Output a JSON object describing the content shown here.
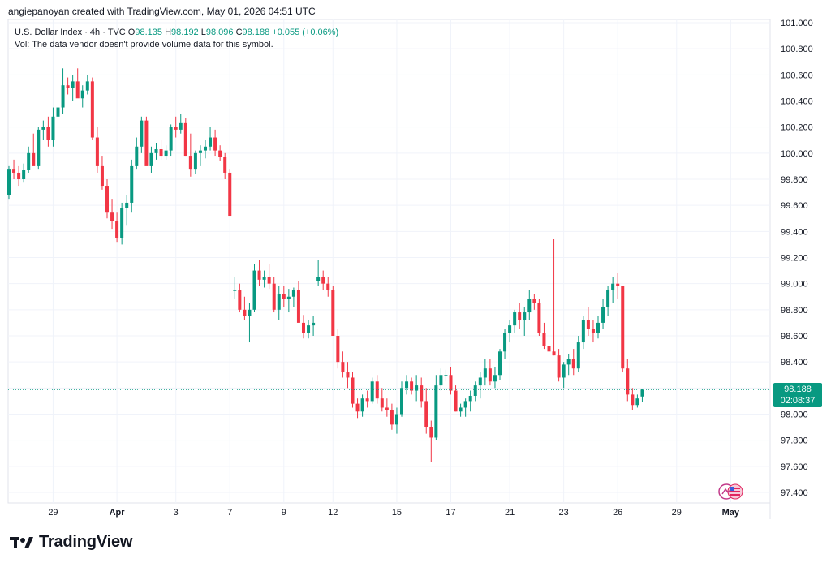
{
  "header": {
    "caption": "angiepanoyan created with TradingView.com, May 01, 2026 04:51 UTC"
  },
  "legend": {
    "symbol": "U.S. Dollar Index · 4h · TVC",
    "open_label": "O",
    "open": "98.135",
    "high_label": "H",
    "high": "98.192",
    "low_label": "L",
    "low": "98.096",
    "close_label": "C",
    "close": "98.188",
    "change": "+0.055 (+0.06%)",
    "volume_note": "Vol: The data vendor doesn't provide volume data for this symbol."
  },
  "price_tag": {
    "price": "98.188",
    "countdown": "02:08:37"
  },
  "footer": {
    "brand": "TradingView",
    "logo_icon": "tradingview-logo-icon"
  },
  "colors": {
    "up": "#089981",
    "down": "#f23645",
    "grid": "#f0f3fa",
    "text": "#131722"
  },
  "chart_data": {
    "type": "candlestick",
    "timeframe": "4h",
    "y_axis": {
      "min": 97.3,
      "max": 101.0,
      "ticks": [
        "101.000",
        "100.800",
        "100.600",
        "100.400",
        "100.200",
        "100.000",
        "99.800",
        "99.600",
        "99.400",
        "99.200",
        "99.000",
        "98.800",
        "98.600",
        "98.400",
        "98.200",
        "98.000",
        "97.800",
        "97.600",
        "97.400"
      ]
    },
    "x_axis": {
      "ticks": [
        {
          "label": "29",
          "bar": 9,
          "bold": false
        },
        {
          "label": "Apr",
          "bar": 22,
          "bold": true
        },
        {
          "label": "3",
          "bar": 34,
          "bold": false
        },
        {
          "label": "7",
          "bar": 45,
          "bold": false
        },
        {
          "label": "9",
          "bar": 56,
          "bold": false
        },
        {
          "label": "12",
          "bar": 66,
          "bold": false
        },
        {
          "label": "15",
          "bar": 79,
          "bold": false
        },
        {
          "label": "17",
          "bar": 90,
          "bold": false
        },
        {
          "label": "21",
          "bar": 102,
          "bold": false
        },
        {
          "label": "23",
          "bar": 113,
          "bold": false
        },
        {
          "label": "26",
          "bar": 124,
          "bold": false
        },
        {
          "label": "29",
          "bar": 136,
          "bold": false
        },
        {
          "label": "May",
          "bar": 147,
          "bold": true
        }
      ]
    },
    "last_price": 98.188,
    "grid": true,
    "candles": [
      [
        99.68,
        99.9,
        99.65,
        99.88
      ],
      [
        99.88,
        99.95,
        99.8,
        99.85
      ],
      [
        99.85,
        99.9,
        99.75,
        99.8
      ],
      [
        99.8,
        99.92,
        99.78,
        99.87
      ],
      [
        99.87,
        100.05,
        99.85,
        100.0
      ],
      [
        100.0,
        100.15,
        99.95,
        99.9
      ],
      [
        99.9,
        100.2,
        99.88,
        100.18
      ],
      [
        100.18,
        100.25,
        100.1,
        100.2
      ],
      [
        100.2,
        100.28,
        100.05,
        100.1
      ],
      [
        100.1,
        100.35,
        100.05,
        100.28
      ],
      [
        100.28,
        100.45,
        100.22,
        100.35
      ],
      [
        100.35,
        100.65,
        100.3,
        100.52
      ],
      [
        100.52,
        100.58,
        100.45,
        100.5
      ],
      [
        100.5,
        100.6,
        100.4,
        100.55
      ],
      [
        100.55,
        100.65,
        100.48,
        100.42
      ],
      [
        100.42,
        100.52,
        100.35,
        100.48
      ],
      [
        100.48,
        100.6,
        100.45,
        100.55
      ],
      [
        100.55,
        100.58,
        100.1,
        100.12
      ],
      [
        100.12,
        100.2,
        99.85,
        99.9
      ],
      [
        99.9,
        99.98,
        99.72,
        99.75
      ],
      [
        99.75,
        99.8,
        99.5,
        99.55
      ],
      [
        99.55,
        99.65,
        99.42,
        99.48
      ],
      [
        99.48,
        99.55,
        99.32,
        99.35
      ],
      [
        99.35,
        99.62,
        99.3,
        99.58
      ],
      [
        99.58,
        99.68,
        99.45,
        99.62
      ],
      [
        99.62,
        99.95,
        99.55,
        99.9
      ],
      [
        99.9,
        100.12,
        99.88,
        100.05
      ],
      [
        100.05,
        100.28,
        100.0,
        100.25
      ],
      [
        100.25,
        100.28,
        99.95,
        99.9
      ],
      [
        99.9,
        100.05,
        99.85,
        100.0
      ],
      [
        100.0,
        100.08,
        99.95,
        100.03
      ],
      [
        100.03,
        100.1,
        99.95,
        99.98
      ],
      [
        99.98,
        100.06,
        99.95,
        100.02
      ],
      [
        100.02,
        100.22,
        99.98,
        100.2
      ],
      [
        100.2,
        100.28,
        100.12,
        100.18
      ],
      [
        100.18,
        100.3,
        100.15,
        100.23
      ],
      [
        100.23,
        100.27,
        99.98,
        99.98
      ],
      [
        99.98,
        100.15,
        99.82,
        99.88
      ],
      [
        99.88,
        100.02,
        99.84,
        100.0
      ],
      [
        100.0,
        100.06,
        99.9,
        100.02
      ],
      [
        100.02,
        100.1,
        99.96,
        100.05
      ],
      [
        100.05,
        100.2,
        100.02,
        100.12
      ],
      [
        100.12,
        100.18,
        99.98,
        100.02
      ],
      [
        100.02,
        100.06,
        99.94,
        99.97
      ],
      [
        99.97,
        100.0,
        99.8,
        99.85
      ],
      [
        99.85,
        99.88,
        99.6,
        99.52
      ],
      [
        98.95,
        99.05,
        98.88,
        98.95
      ],
      [
        98.95,
        99.0,
        98.78,
        98.8
      ],
      [
        98.8,
        98.9,
        98.72,
        98.75
      ],
      [
        98.75,
        98.85,
        98.55,
        98.8
      ],
      [
        98.8,
        99.15,
        98.78,
        99.1
      ],
      [
        99.1,
        99.18,
        98.98,
        99.03
      ],
      [
        99.03,
        99.1,
        98.97,
        99.05
      ],
      [
        99.05,
        99.15,
        98.96,
        99.0
      ],
      [
        99.0,
        99.05,
        98.78,
        98.8
      ],
      [
        98.8,
        98.98,
        98.72,
        98.92
      ],
      [
        98.92,
        98.98,
        98.82,
        98.88
      ],
      [
        98.88,
        98.96,
        98.78,
        98.9
      ],
      [
        98.9,
        98.97,
        98.82,
        98.95
      ],
      [
        98.95,
        99.02,
        98.75,
        98.7
      ],
      [
        98.7,
        98.76,
        98.58,
        98.62
      ],
      [
        98.62,
        98.72,
        98.58,
        98.68
      ],
      [
        98.68,
        98.75,
        98.6,
        98.7
      ],
      [
        99.02,
        99.18,
        98.98,
        99.05
      ],
      [
        99.05,
        99.1,
        98.95,
        99.0
      ],
      [
        99.0,
        99.05,
        98.9,
        98.95
      ],
      [
        98.95,
        98.98,
        98.6,
        98.6
      ],
      [
        98.6,
        98.65,
        98.35,
        98.4
      ],
      [
        98.4,
        98.48,
        98.28,
        98.32
      ],
      [
        98.32,
        98.4,
        98.2,
        98.28
      ],
      [
        98.28,
        98.32,
        98.05,
        98.08
      ],
      [
        98.08,
        98.12,
        97.97,
        98.02
      ],
      [
        98.02,
        98.15,
        97.98,
        98.12
      ],
      [
        98.12,
        98.18,
        98.05,
        98.1
      ],
      [
        98.1,
        98.28,
        98.08,
        98.25
      ],
      [
        98.25,
        98.3,
        98.08,
        98.12
      ],
      [
        98.12,
        98.2,
        98.02,
        98.05
      ],
      [
        98.05,
        98.12,
        97.98,
        98.03
      ],
      [
        98.03,
        98.08,
        97.88,
        97.92
      ],
      [
        97.92,
        98.05,
        97.85,
        98.0
      ],
      [
        98.0,
        98.25,
        97.98,
        98.2
      ],
      [
        98.2,
        98.3,
        98.15,
        98.25
      ],
      [
        98.25,
        98.28,
        98.15,
        98.18
      ],
      [
        98.18,
        98.3,
        98.1,
        98.22
      ],
      [
        98.22,
        98.28,
        98.05,
        98.1
      ],
      [
        98.1,
        98.2,
        97.85,
        97.9
      ],
      [
        97.9,
        97.95,
        97.63,
        97.82
      ],
      [
        97.82,
        98.3,
        97.8,
        98.22
      ],
      [
        98.22,
        98.35,
        98.18,
        98.3
      ],
      [
        98.3,
        98.34,
        98.25,
        98.3
      ],
      [
        98.3,
        98.36,
        98.15,
        98.18
      ],
      [
        98.18,
        98.22,
        98.02,
        98.02
      ],
      [
        98.02,
        98.08,
        97.98,
        98.05
      ],
      [
        98.05,
        98.12,
        97.98,
        98.1
      ],
      [
        98.1,
        98.18,
        98.02,
        98.14
      ],
      [
        98.14,
        98.25,
        98.1,
        98.22
      ],
      [
        98.22,
        98.32,
        98.12,
        98.28
      ],
      [
        98.28,
        98.42,
        98.22,
        98.35
      ],
      [
        98.35,
        98.42,
        98.22,
        98.25
      ],
      [
        98.25,
        98.36,
        98.2,
        98.3
      ],
      [
        98.3,
        98.5,
        98.26,
        98.48
      ],
      [
        98.48,
        98.65,
        98.42,
        98.62
      ],
      [
        98.62,
        98.72,
        98.55,
        98.68
      ],
      [
        98.68,
        98.8,
        98.62,
        98.78
      ],
      [
        98.78,
        98.85,
        98.65,
        98.72
      ],
      [
        98.72,
        98.82,
        98.6,
        98.78
      ],
      [
        98.78,
        98.95,
        98.72,
        98.88
      ],
      [
        98.88,
        98.92,
        98.8,
        98.85
      ],
      [
        98.85,
        98.88,
        98.6,
        98.62
      ],
      [
        98.62,
        98.7,
        98.5,
        98.52
      ],
      [
        98.52,
        98.6,
        98.45,
        98.48
      ],
      [
        98.48,
        99.34,
        98.45,
        98.45
      ],
      [
        98.45,
        98.5,
        98.25,
        98.28
      ],
      [
        98.28,
        98.4,
        98.2,
        98.38
      ],
      [
        98.38,
        98.46,
        98.3,
        98.42
      ],
      [
        98.42,
        98.5,
        98.3,
        98.35
      ],
      [
        98.35,
        98.6,
        98.32,
        98.55
      ],
      [
        98.55,
        98.75,
        98.5,
        98.72
      ],
      [
        98.72,
        98.82,
        98.6,
        98.65
      ],
      [
        98.65,
        98.72,
        98.55,
        98.62
      ],
      [
        98.62,
        98.75,
        98.58,
        98.7
      ],
      [
        98.7,
        98.88,
        98.65,
        98.82
      ],
      [
        98.82,
        98.98,
        98.75,
        98.95
      ],
      [
        98.95,
        99.05,
        98.85,
        99.0
      ],
      [
        99.0,
        99.08,
        98.88,
        98.98
      ],
      [
        98.98,
        98.98,
        98.32,
        98.35
      ],
      [
        98.35,
        98.42,
        98.1,
        98.15
      ],
      [
        98.15,
        98.2,
        98.03,
        98.07
      ],
      [
        98.07,
        98.15,
        98.05,
        98.12
      ],
      [
        98.135,
        98.192,
        98.096,
        98.188
      ]
    ]
  }
}
